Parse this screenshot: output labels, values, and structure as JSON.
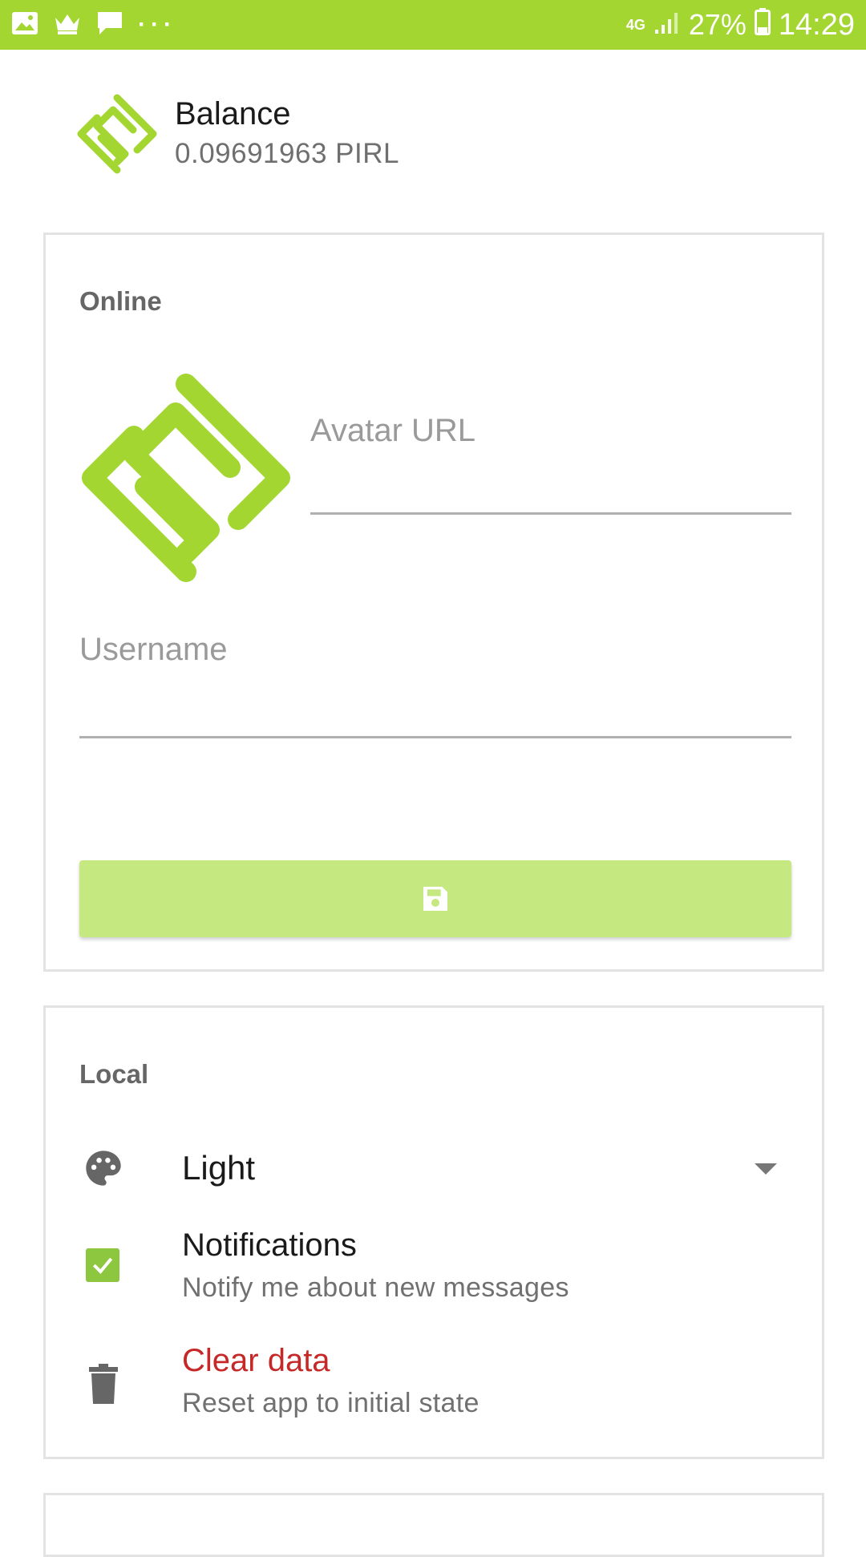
{
  "status_bar": {
    "network": "4G",
    "battery": "27%",
    "time": "14:29"
  },
  "header": {
    "title": "Balance",
    "balance": "0.09691963 PIRL"
  },
  "online": {
    "section_title": "Online",
    "avatar_url_label": "Avatar URL",
    "avatar_url_value": "",
    "username_label": "Username",
    "username_value": "",
    "save_icon": "save-icon"
  },
  "local": {
    "section_title": "Local",
    "theme_value": "Light",
    "theme_icon": "palette-icon",
    "notifications_title": "Notifications",
    "notifications_subtitle": "Notify me about new messages",
    "notifications_checked": true,
    "clear_title": "Clear data",
    "clear_subtitle": "Reset app to initial state",
    "clear_icon": "trash-icon"
  },
  "colors": {
    "accent": "#a3d631",
    "button": "#c5e880",
    "danger": "#c62828"
  }
}
